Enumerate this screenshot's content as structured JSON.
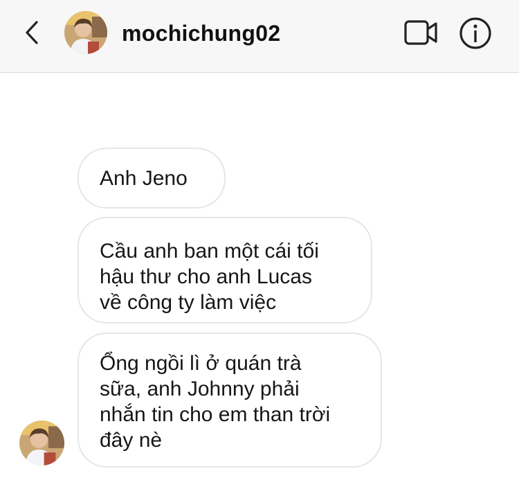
{
  "header": {
    "back_icon": "chevron-left-icon",
    "avatar_icon": "profile-photo-avatar",
    "username": "mochichung02",
    "video_call_icon": "video-camera-icon",
    "info_icon": "info-icon"
  },
  "messages": [
    {
      "sender": "mochichung02",
      "text": "Anh Jeno"
    },
    {
      "sender": "mochichung02",
      "text": "Cầu anh ban một cái tối\nhậu thư cho anh Lucas\nvề công ty làm việc"
    },
    {
      "sender": "mochichung02",
      "text": "Ổng ngồi lì ở quán trà\nsữa, anh Johnny phải\nnhắn tin cho em than trời\nđây nè"
    }
  ],
  "colors": {
    "header_bg": "#f7f7f7",
    "bubble_border": "#e6e6e6",
    "text": "#111111"
  }
}
